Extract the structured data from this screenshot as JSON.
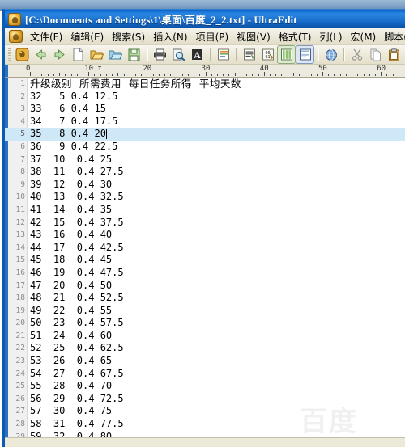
{
  "window": {
    "title": "[C:\\Documents and Settings\\1\\桌面\\百度_2_2.txt] - UltraEdit",
    "app_name": "UltraEdit",
    "icon": "ultraedit-app-icon",
    "titlebar_color": "#1a74d0"
  },
  "menubar": {
    "icon": "document-menu-icon",
    "items": [
      {
        "label": "文件(F)",
        "name": "menu-file"
      },
      {
        "label": "编辑(E)",
        "name": "menu-edit"
      },
      {
        "label": "搜索(S)",
        "name": "menu-search"
      },
      {
        "label": "插入(N)",
        "name": "menu-insert"
      },
      {
        "label": "项目(P)",
        "name": "menu-project"
      },
      {
        "label": "视图(V)",
        "name": "menu-view"
      },
      {
        "label": "格式(T)",
        "name": "menu-format"
      },
      {
        "label": "列(L)",
        "name": "menu-column"
      },
      {
        "label": "宏(M)",
        "name": "menu-macro"
      },
      {
        "label": "脚本(i)",
        "name": "menu-script"
      }
    ]
  },
  "toolbar": {
    "buttons": [
      {
        "icon": "app-logo-icon",
        "name": "toolbar-app-logo"
      },
      {
        "icon": "back-arrow-icon",
        "name": "toolbar-back"
      },
      {
        "icon": "forward-arrow-icon",
        "name": "toolbar-forward"
      },
      {
        "icon": "new-file-icon",
        "name": "toolbar-new-file"
      },
      {
        "icon": "open-folder-icon",
        "name": "toolbar-open-file"
      },
      {
        "icon": "open-folder-blue-icon",
        "name": "toolbar-open-recent"
      },
      {
        "icon": "save-disk-icon",
        "name": "toolbar-save"
      },
      {
        "icon": "printer-icon",
        "name": "toolbar-print"
      },
      {
        "icon": "print-preview-icon",
        "name": "toolbar-print-preview"
      },
      {
        "icon": "font-A-icon",
        "name": "toolbar-font"
      },
      {
        "icon": "word-wrap-icon",
        "name": "toolbar-word-wrap"
      },
      {
        "icon": "list-lines-icon",
        "name": "toolbar-show-lines"
      },
      {
        "icon": "hex-edit-icon",
        "name": "toolbar-hex-edit"
      },
      {
        "icon": "column-mode-icon",
        "name": "toolbar-column-mode"
      },
      {
        "icon": "page-view-icon",
        "name": "toolbar-page-view"
      },
      {
        "icon": "globe-icon",
        "name": "toolbar-web-search"
      },
      {
        "icon": "cut-scissors-icon",
        "name": "toolbar-cut"
      },
      {
        "icon": "copy-icon",
        "name": "toolbar-copy"
      },
      {
        "icon": "paste-clipboard-icon",
        "name": "toolbar-paste"
      }
    ]
  },
  "ruler": {
    "labels": [
      "0",
      "10",
      "20",
      "30",
      "40",
      "50",
      "60"
    ],
    "tab_marker": "T"
  },
  "editor": {
    "current_line": 5,
    "current_line_highlight": "#cfe8f7",
    "caret_after_text": "35  8 0.4 20",
    "header_line": {
      "number": "1",
      "text": "升级级别  所需费用  每日任务所得  平均天数"
    },
    "lines": [
      {
        "number": "1",
        "text": "升级级别  所需费用  每日任务所得  平均天数",
        "cjk": true
      },
      {
        "number": "2",
        "text": "32   5 0.4 12.5"
      },
      {
        "number": "3",
        "text": "33   6 0.4 15"
      },
      {
        "number": "4",
        "text": "34   7 0.4 17.5"
      },
      {
        "number": "5",
        "text": "35   8 0.4 20"
      },
      {
        "number": "6",
        "text": "36   9 0.4 22.5"
      },
      {
        "number": "7",
        "text": "37  10  0.4 25"
      },
      {
        "number": "8",
        "text": "38  11  0.4 27.5"
      },
      {
        "number": "9",
        "text": "39  12  0.4 30"
      },
      {
        "number": "10",
        "text": "40  13  0.4 32.5"
      },
      {
        "number": "11",
        "text": "41  14  0.4 35"
      },
      {
        "number": "12",
        "text": "42  15  0.4 37.5"
      },
      {
        "number": "13",
        "text": "43  16  0.4 40"
      },
      {
        "number": "14",
        "text": "44  17  0.4 42.5"
      },
      {
        "number": "15",
        "text": "45  18  0.4 45"
      },
      {
        "number": "16",
        "text": "46  19  0.4 47.5"
      },
      {
        "number": "17",
        "text": "47  20  0.4 50"
      },
      {
        "number": "18",
        "text": "48  21  0.4 52.5"
      },
      {
        "number": "19",
        "text": "49  22  0.4 55"
      },
      {
        "number": "20",
        "text": "50  23  0.4 57.5"
      },
      {
        "number": "21",
        "text": "51  24  0.4 60"
      },
      {
        "number": "22",
        "text": "52  25  0.4 62.5"
      },
      {
        "number": "23",
        "text": "53  26  0.4 65"
      },
      {
        "number": "24",
        "text": "54  27  0.4 67.5"
      },
      {
        "number": "25",
        "text": "55  28  0.4 70"
      },
      {
        "number": "26",
        "text": "56  29  0.4 72.5"
      },
      {
        "number": "27",
        "text": "57  30  0.4 75"
      },
      {
        "number": "28",
        "text": "58  31  0.4 77.5"
      },
      {
        "number": "29",
        "text": "59  32  0.4 80"
      }
    ]
  },
  "watermark": {
    "text": "百度"
  }
}
